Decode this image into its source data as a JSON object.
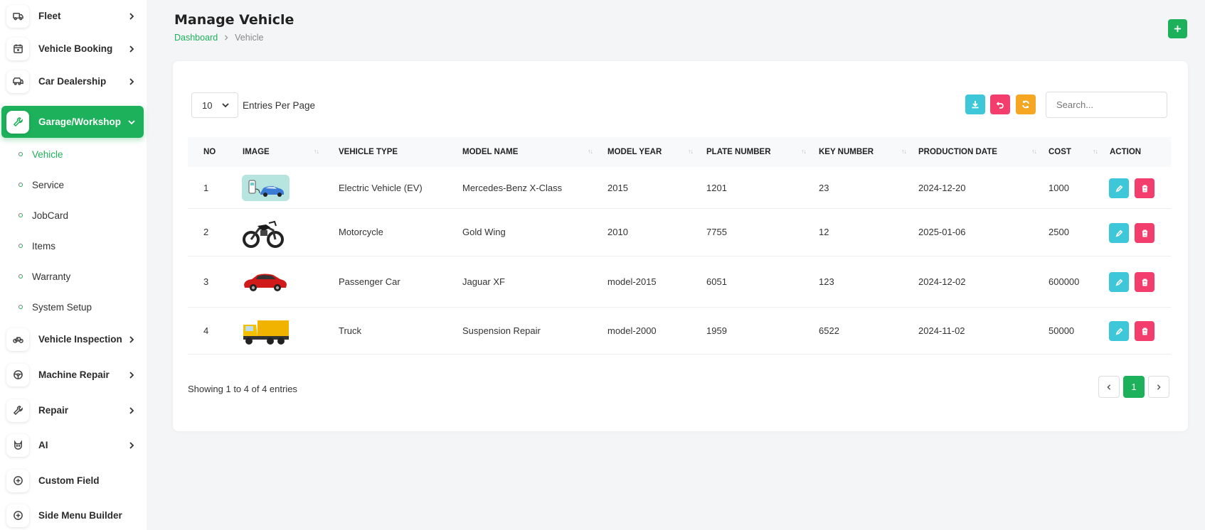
{
  "sidebar": {
    "items": [
      {
        "label": "Fleet",
        "icon": "truck-icon"
      },
      {
        "label": "Vehicle Booking",
        "icon": "calendar-icon"
      },
      {
        "label": "Car Dealership",
        "icon": "dealership-icon"
      },
      {
        "label": "Garage/Workshop",
        "icon": "wrench-icon",
        "active": true
      },
      {
        "label": "Vehicle Inspection",
        "icon": "bicycle-icon"
      },
      {
        "label": "Machine Repair",
        "icon": "steering-wheel-icon"
      },
      {
        "label": "Repair",
        "icon": "wrench-icon"
      },
      {
        "label": "AI",
        "icon": "ai-icon"
      },
      {
        "label": "Custom Field",
        "icon": "plus-circle-icon"
      },
      {
        "label": "Side Menu Builder",
        "icon": "plus-circle-icon"
      }
    ],
    "submenu": [
      "Vehicle",
      "Service",
      "JobCard",
      "Items",
      "Warranty",
      "System Setup"
    ]
  },
  "header": {
    "title": "Manage Vehicle",
    "breadcrumb_home": "Dashboard",
    "breadcrumb_current": "Vehicle"
  },
  "toolbar": {
    "entries_value": "10",
    "entries_label": "Entries Per Page",
    "search_placeholder": "Search...",
    "colors": {
      "download": "#3ec7d8",
      "reset": "#f33d6c",
      "refresh": "#f5a623",
      "primary": "#1cb15a"
    }
  },
  "table": {
    "columns": [
      "NO",
      "IMAGE",
      "VEHICLE TYPE",
      "MODEL NAME",
      "MODEL YEAR",
      "PLATE NUMBER",
      "KEY NUMBER",
      "PRODUCTION DATE",
      "COST",
      "ACTION"
    ],
    "rows": [
      {
        "no": "1",
        "image": "electric-vehicle-image",
        "type": "Electric Vehicle (EV)",
        "model": "Mercedes-Benz X-Class",
        "year": "2015",
        "plate": "1201",
        "key": "23",
        "date": "2024-12-20",
        "cost": "1000"
      },
      {
        "no": "2",
        "image": "motorcycle-image",
        "type": "Motorcycle",
        "model": "Gold Wing",
        "year": "2010",
        "plate": "7755",
        "key": "12",
        "date": "2025-01-06",
        "cost": "2500"
      },
      {
        "no": "3",
        "image": "red-car-image",
        "type": "Passenger Car",
        "model": "Jaguar XF",
        "year": "model-2015",
        "plate": "6051",
        "key": "123",
        "date": "2024-12-02",
        "cost": "600000"
      },
      {
        "no": "4",
        "image": "truck-image",
        "type": "Truck",
        "model": "Suspension Repair",
        "year": "model-2000",
        "plate": "1959",
        "key": "6522",
        "date": "2024-11-02",
        "cost": "50000"
      }
    ]
  },
  "footer": {
    "showing": "Showing 1 to 4 of 4 entries",
    "current_page": "1"
  }
}
